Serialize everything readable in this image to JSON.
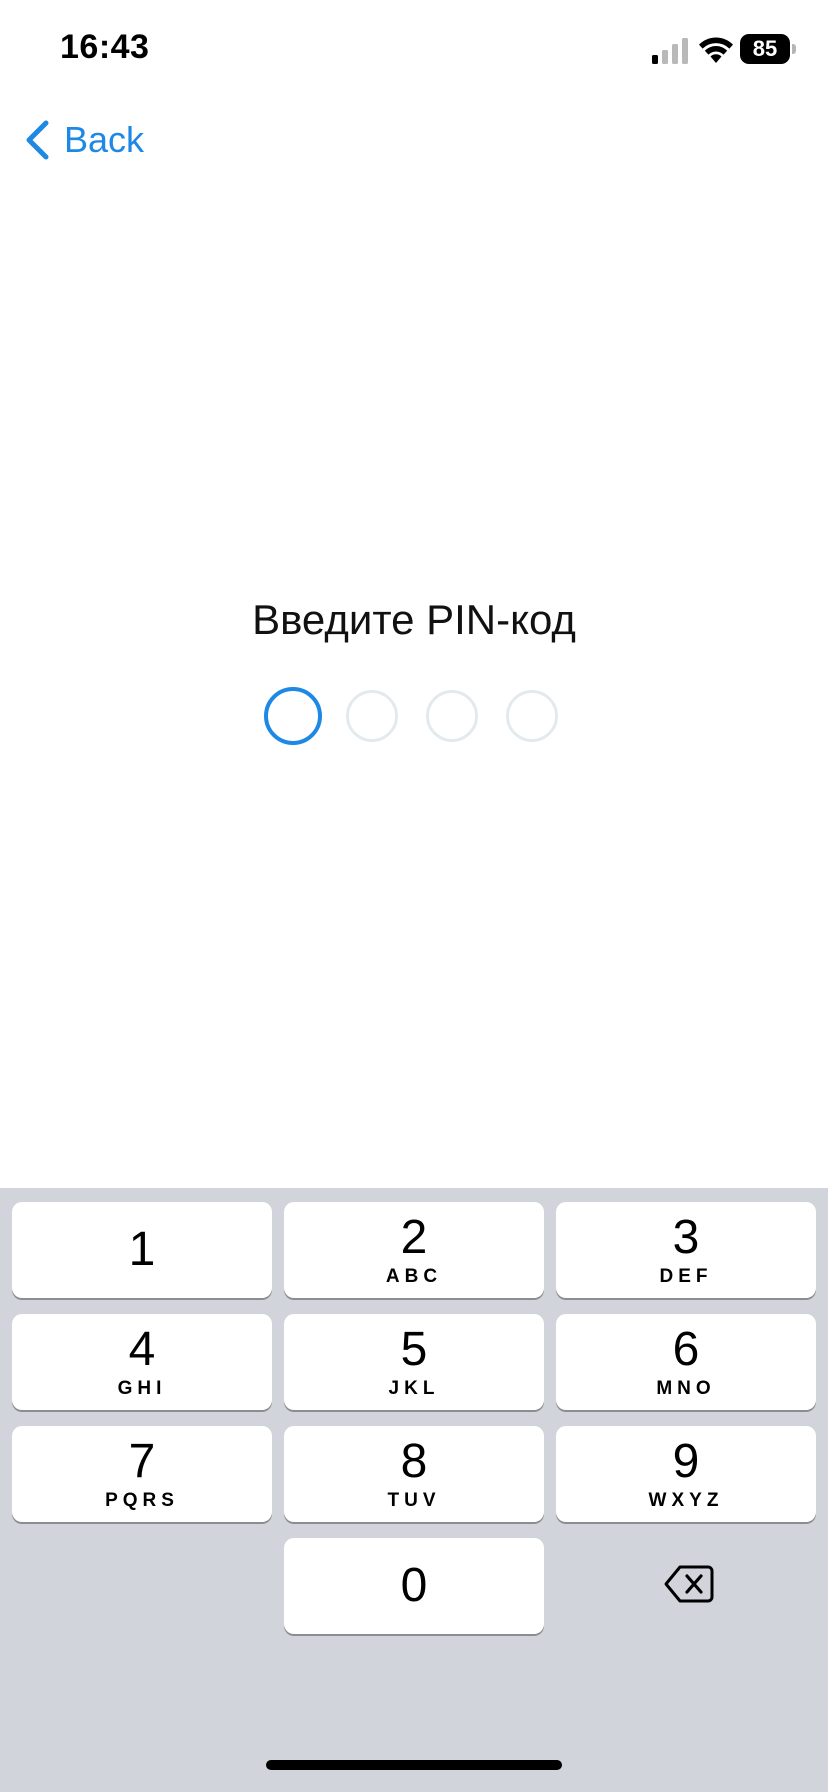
{
  "status_bar": {
    "time": "16:43",
    "battery_level": "85",
    "signal_icon": "cellular-signal-icon",
    "wifi_icon": "wifi-icon"
  },
  "nav": {
    "back_label": "Back",
    "back_icon": "chevron-left-icon"
  },
  "pin": {
    "title": "Введите PIN-код",
    "length": 4,
    "entered": 0
  },
  "keypad": {
    "keys": [
      {
        "digit": "1",
        "letters": ""
      },
      {
        "digit": "2",
        "letters": "ABC"
      },
      {
        "digit": "3",
        "letters": "DEF"
      },
      {
        "digit": "4",
        "letters": "GHI"
      },
      {
        "digit": "5",
        "letters": "JKL"
      },
      {
        "digit": "6",
        "letters": "MNO"
      },
      {
        "digit": "7",
        "letters": "PQRS"
      },
      {
        "digit": "8",
        "letters": "TUV"
      },
      {
        "digit": "9",
        "letters": "WXYZ"
      },
      {
        "digit": "0",
        "letters": ""
      }
    ],
    "delete_icon": "backspace-icon"
  },
  "colors": {
    "accent": "#1e88e5",
    "keypad_background": "#d1d5db",
    "dot_inactive": "#e3eaee"
  }
}
